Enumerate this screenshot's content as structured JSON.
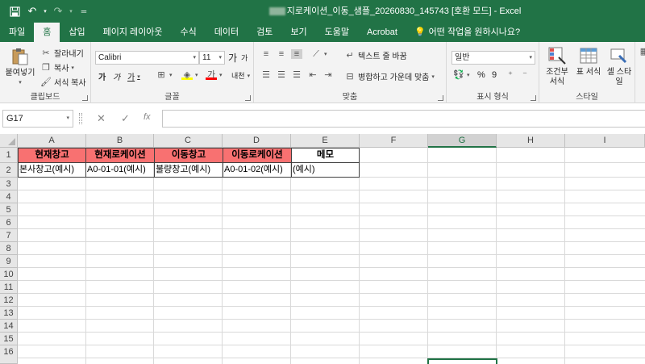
{
  "window": {
    "title": "지로케이션_이동_샘플_20260830_145743  [호환 모드]  -  Excel"
  },
  "colors": {
    "brand": "#217346",
    "header_red": "#f87171",
    "header_blue": "#ffffff"
  },
  "tabs": [
    "파일",
    "홈",
    "삽입",
    "페이지 레이아웃",
    "수식",
    "데이터",
    "검토",
    "보기",
    "도움말",
    "Acrobat"
  ],
  "search_text": "어떤 작업을 원하시나요?",
  "ribbon": {
    "clipboard": {
      "paste": "붙여넣기",
      "cut": "잘라내기",
      "copy": "복사",
      "format_painter": "서식 복사",
      "label": "클립보드"
    },
    "font": {
      "name": "Calibri",
      "size": "11",
      "label": "글꼴",
      "grow": "가",
      "shrink": "가",
      "bold": "가",
      "italic": "가",
      "underline": "가",
      "strike": "내천"
    },
    "alignment": {
      "wrap": "텍스트 줄 바꿈",
      "merge": "병합하고 가운데 맞춤",
      "label": "맞춤"
    },
    "number": {
      "format": "일반",
      "label": "표시 형식",
      "percent": "%",
      "comma": "9"
    },
    "styles": {
      "conditional": "조건부 서식",
      "table": "표 서식",
      "cell": "셀 스타일",
      "label": "스타일"
    }
  },
  "formula_bar": {
    "name_box": "G17",
    "fx": "fx",
    "value": ""
  },
  "sheet": {
    "columns": [
      "A",
      "B",
      "C",
      "D",
      "E",
      "F",
      "G",
      "H",
      "I"
    ],
    "rows": [
      "1",
      "2",
      "3",
      "4",
      "5",
      "6",
      "7",
      "8",
      "9",
      "10",
      "11",
      "12",
      "13",
      "14",
      "15",
      "16"
    ],
    "headers": [
      "현재창고",
      "현재로케이션",
      "이동창고",
      "이동로케이션",
      "메모"
    ],
    "row2": [
      "본사창고(예시)",
      "A0-01-01(예시)",
      "불량창고(예시)",
      "A0-01-02(예시)",
      "(예시)"
    ]
  }
}
